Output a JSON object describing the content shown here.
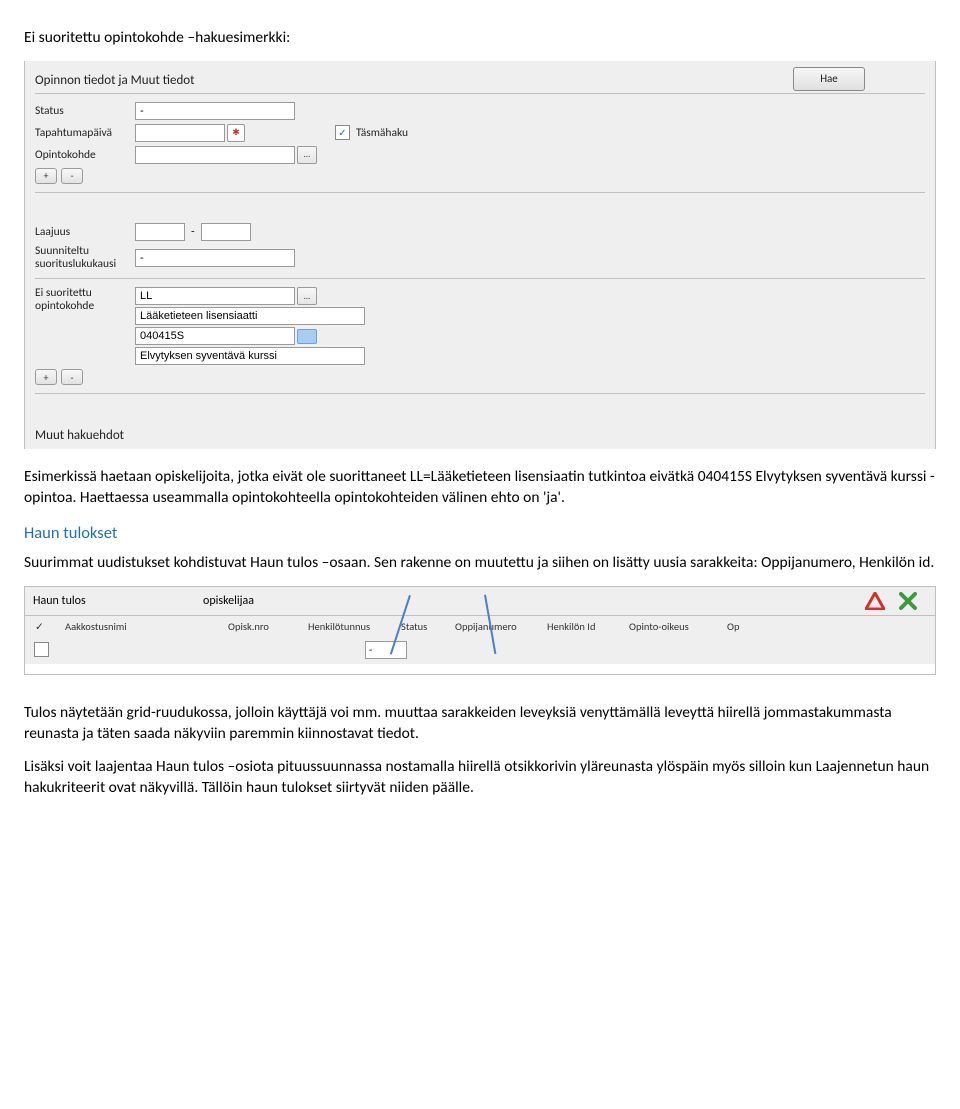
{
  "doc": {
    "title_line": "Ei suoritettu opintokohde –hakuesimerkki:",
    "para1": "Esimerkissä haetaan opiskelijoita, jotka eivät ole suorittaneet LL=Lääketieteen lisensiaatin tutkintoa eivätkä 040415S Elvytyksen syventävä kurssi -opintoa. Haettaessa useammalla opintokohteella opintokohteiden välinen ehto on 'ja'.",
    "heading_results": "Haun tulokset",
    "para2": "Suurimmat uudistukset kohdistuvat Haun tulos –osaan. Sen rakenne on muutettu ja siihen on lisätty uusia sarakkeita: Oppijanumero, Henkilön id.",
    "para3": "Tulos näytetään grid-ruudukossa, jolloin käyttäjä voi mm. muuttaa sarakkeiden leveyksiä venyttämällä leveyttä hiirellä jommastakummasta reunasta ja täten saada näkyviin paremmin kiinnostavat tiedot.",
    "para4": "Lisäksi voit laajentaa Haun tulos –osiota pituussuunnassa nostamalla hiirellä otsikkorivin yläreunasta ylöspäin myös silloin kun Laajennetun haun hakukriteerit ovat näkyvillä. Tällöin haun tulokset siirtyvät niiden päälle."
  },
  "form": {
    "section1_title": "Opinnon tiedot ja Muut tiedot",
    "search_btn": "Hae",
    "labels": {
      "status": "Status",
      "tapahtumapaiva": "Tapahtumapäivä",
      "opintokohde": "Opintokohde",
      "tasmahaku": "Täsmähaku",
      "laajuus": "Laajuus",
      "suunniteltu": "Suunniteltu suorituslukukausi",
      "ei_suoritettu": "Ei suoritettu opintokohde",
      "muut": "Muut hakuehdot"
    },
    "status_value": "-",
    "suunniteltu_value": "-",
    "ei": {
      "code": "LL",
      "name": "Lääketieteen lisensiaatti",
      "code2": "040415S",
      "name2": "Elvytyksen syventävä kurssi"
    },
    "plus": "+",
    "minus": "-",
    "check": "✓"
  },
  "grid": {
    "title": "Haun tulos",
    "sort_by": "opiskelijaa",
    "columns": {
      "chk": "✓",
      "aak": "Aakkostusnimi",
      "opnro": "Opisk.nro",
      "ht": "Henkilötunnus",
      "status": "Status",
      "oj": "Oppijanumero",
      "hid": "Henkilön Id",
      "oo": "Opinto-oikeus",
      "op": "Op"
    },
    "filter_status": "-"
  }
}
